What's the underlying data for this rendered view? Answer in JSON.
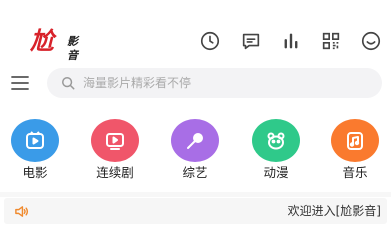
{
  "header": {
    "logo_main": "尬",
    "logo_sub": "影音",
    "actions": [
      {
        "icon": "history-clock-icon"
      },
      {
        "icon": "message-bubble-icon"
      },
      {
        "icon": "ranking-bars-icon"
      },
      {
        "icon": "qr-scan-icon"
      },
      {
        "icon": "smile-face-icon"
      }
    ]
  },
  "search": {
    "placeholder": "海量影片精彩看不停"
  },
  "categories": [
    {
      "label": "电影",
      "icon": "film-icon",
      "color": "#3a9be8"
    },
    {
      "label": "连续剧",
      "icon": "tv-icon",
      "color": "#f0566a"
    },
    {
      "label": "综艺",
      "icon": "microphone-icon",
      "color": "#a86ee6"
    },
    {
      "label": "动漫",
      "icon": "bear-face-icon",
      "color": "#2fc98a"
    },
    {
      "label": "音乐",
      "icon": "music-box-icon",
      "color": "#fa7a2e"
    }
  ],
  "notice": {
    "text": "欢迎进入[尬影音]"
  },
  "colors": {
    "logo_red": "#d8222a",
    "speaker_orange": "#f08a2e",
    "icon_gray": "#444444"
  }
}
